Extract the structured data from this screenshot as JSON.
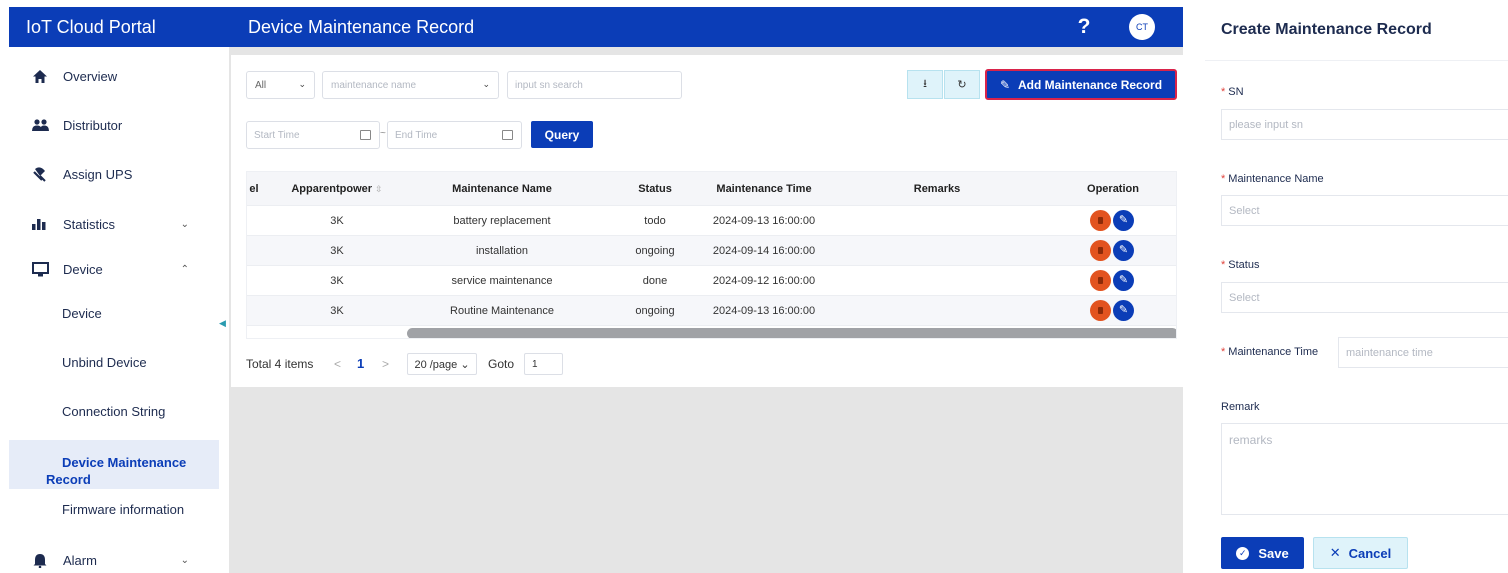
{
  "header": {
    "brand": "IoT Cloud Portal",
    "page_title": "Device Maintenance Record",
    "help": "?",
    "avatar": "CT"
  },
  "sidebar": {
    "items": [
      {
        "label": "Overview",
        "icon": "home-icon"
      },
      {
        "label": "Distributor",
        "icon": "users-icon"
      },
      {
        "label": "Assign UPS",
        "icon": "plug-icon"
      },
      {
        "label": "Statistics",
        "icon": "bar-chart-icon",
        "chevron": "⌄"
      },
      {
        "label": "Device",
        "icon": "monitor-icon",
        "chevron": "⌃"
      }
    ],
    "sub_items": [
      {
        "label": "Device"
      },
      {
        "label": "Unbind Device"
      },
      {
        "label": "Connection String"
      },
      {
        "label_line1": "Device Maintenance",
        "label_line2": "Record",
        "active": true
      },
      {
        "label": "Firmware information"
      }
    ],
    "alarm": {
      "label": "Alarm",
      "icon": "bell-icon",
      "chevron": "⌄"
    }
  },
  "filters": {
    "type_select": "All",
    "maintenance_select_placeholder": "maintenance name",
    "sn_search_placeholder": "input sn search",
    "start_time_placeholder": "Start Time",
    "range_separator": "~",
    "end_time_placeholder": "End Time",
    "query_label": "Query"
  },
  "toolbar": {
    "download_glyph": "⭳",
    "refresh_glyph": "↻",
    "add_label": "Add Maintenance Record"
  },
  "table": {
    "columns": {
      "model": "el",
      "apparent_power": "Apparentpower",
      "maintenance_name": "Maintenance Name",
      "status": "Status",
      "maintenance_time": "Maintenance Time",
      "remarks": "Remarks",
      "operation": "Operation"
    },
    "rows": [
      {
        "apparent_power": "3K",
        "maintenance_name": "battery replacement",
        "status": "todo",
        "maintenance_time": "2024-09-13 16:00:00",
        "remarks": ""
      },
      {
        "apparent_power": "3K",
        "maintenance_name": "installation",
        "status": "ongoing",
        "maintenance_time": "2024-09-14 16:00:00",
        "remarks": ""
      },
      {
        "apparent_power": "3K",
        "maintenance_name": "service maintenance",
        "status": "done",
        "maintenance_time": "2024-09-12 16:00:00",
        "remarks": ""
      },
      {
        "apparent_power": "3K",
        "maintenance_name": "Routine Maintenance",
        "status": "ongoing",
        "maintenance_time": "2024-09-13 16:00:00",
        "remarks": ""
      }
    ]
  },
  "pagination": {
    "total": "Total 4 items",
    "prev": "<",
    "current": "1",
    "next": ">",
    "page_size": "20 /page ⌄",
    "goto_label": "Goto",
    "goto_value": "1"
  },
  "form": {
    "title": "Create Maintenance Record",
    "sn_label": "SN",
    "sn_placeholder": "please input sn",
    "maintenance_name_label": "Maintenance Name",
    "maintenance_name_placeholder": "Select",
    "status_label": "Status",
    "status_placeholder": "Select",
    "maintenance_time_label": "Maintenance Time",
    "maintenance_time_placeholder": "maintenance time",
    "remark_label": "Remark",
    "remark_placeholder": "remarks",
    "save_label": "Save",
    "cancel_label": "Cancel",
    "required_mark": "*"
  },
  "colors": {
    "primary": "#0b3db7",
    "danger": "#e2531f",
    "highlight_border": "#d9234a",
    "light_button": "#dff3fa"
  }
}
